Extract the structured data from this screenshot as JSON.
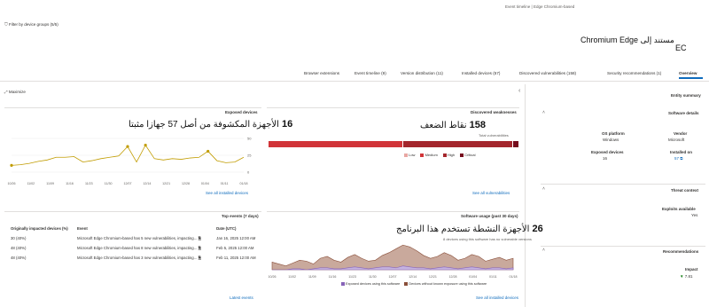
{
  "breadcrumb": {
    "item1": "Event timeline",
    "sep": "|",
    "item2": "Edge Chromium-based"
  },
  "filter_label": "Filter by device groups (5/5)",
  "header": {
    "avatar_initials": "EC",
    "title": "مستند إلى Chromium Edge"
  },
  "tabs": [
    "Overview",
    "Security recommendations (1)",
    "Discovered vulnerabilities (158)",
    "Installed devices (57)",
    "Version distribution (11)",
    "Event timeline (9)",
    "Browser extensions"
  ],
  "maximize_label": "Maximize",
  "entity_summary": {
    "title": "Entity summary",
    "software_details": {
      "title": "Software details",
      "vendor_label": "Vendor",
      "vendor_value": "Microsoft",
      "os_label": "OS platform",
      "os_value": "Windows",
      "exposed_label": "Exposed devices",
      "exposed_value": "16",
      "installed_label": "Installed on",
      "installed_value": "57"
    },
    "threat_context": {
      "title": "Threat context",
      "exploits_label": "Exploits available",
      "exploits_value": "Yes"
    },
    "recommendations": {
      "title": "Recommendations",
      "impact_label": "Impact",
      "impact_value": "7.81"
    }
  },
  "discovered_weaknesses": {
    "title": "Discovered weaknesses",
    "count": "158",
    "caption": "نقاط الضعف",
    "subtitle": "Total vulnerabilities",
    "legend": [
      "Critical",
      "High",
      "Medium",
      "Low"
    ],
    "colors": {
      "critical": "#750b1c",
      "high": "#a4262c",
      "medium": "#d13438",
      "low": "#e8a7a3"
    },
    "segments": [
      0.02,
      0.44,
      0.54,
      0.0
    ],
    "link": "See all vulnerabilities"
  },
  "exposed_devices": {
    "title": "Exposed devices",
    "count": "16",
    "caption": "الأجهزة المكشوفة من أصل 57 جهازا مثبتا",
    "link": "See all installed devices"
  },
  "software_usage": {
    "title": "Software usage (past 30 days)",
    "count": "26",
    "caption": "الأجهزة النشطة تستخدم هذا البرنامج",
    "subtitle": "8 devices using this software has no vulnerable versions",
    "legend": [
      "Devices without known exposure using this software",
      "Exposed devices using this software"
    ],
    "colors": {
      "total": "#8a4f3a",
      "total_fill": "#c9a99c",
      "exposed": "#8764b8",
      "exposed_fill": "#c5b3e0"
    },
    "link": "See all installed devices"
  },
  "top_events": {
    "title": "Top events (7 days)",
    "columns": [
      "Date (UTC)",
      "Event",
      "Originally impacted devices (%)"
    ],
    "rows": [
      {
        "date": "Jan 16, 2025 12:00 AM",
        "event": "Microsoft Edge Chromium-based has 5 new vulnerabilities, impacting...",
        "pct": "30 (40%)"
      },
      {
        "date": "Feb 5, 2025 12:00 AM",
        "event": "Microsoft Edge Chromium-based has 8 new vulnerabilities, impacting...",
        "pct": "48 (40%)"
      },
      {
        "date": "Feb 11, 2025 12:00 AM",
        "event": "Microsoft Edge Chromium-based has 3 new vulnerabilities, impacting...",
        "pct": "48 (40%)"
      }
    ],
    "link": "Latest events"
  },
  "chart_data": [
    {
      "type": "line",
      "title": "Exposed devices",
      "x": [
        "10/26",
        "11/02",
        "11/09",
        "11/16",
        "11/23",
        "11/30",
        "12/07",
        "12/14",
        "12/21",
        "12/28",
        "01/04",
        "01/11",
        "01/18"
      ],
      "series": [
        {
          "values": [
            10,
            11,
            13,
            16,
            18,
            22,
            22,
            23,
            15,
            17,
            20,
            22,
            24,
            38,
            15,
            40,
            20,
            18,
            20,
            19,
            21,
            22,
            31,
            17,
            14,
            15,
            22
          ]
        }
      ],
      "yticks": [
        "50",
        "25",
        "0"
      ],
      "ylim": [
        0,
        50
      ],
      "color": "#c19c00"
    },
    {
      "type": "area",
      "title": "Software usage (past 30 days)",
      "x": [
        "10/26",
        "11/02",
        "11/09",
        "11/16",
        "11/23",
        "11/30",
        "12/07",
        "12/14",
        "12/21",
        "12/28",
        "01/04",
        "01/11",
        "01/18"
      ],
      "series": [
        {
          "name": "Devices without known exposure using this software",
          "values": [
            8,
            6,
            4,
            7,
            10,
            9,
            6,
            12,
            14,
            10,
            8,
            13,
            16,
            12,
            9,
            10,
            15,
            18,
            22,
            26,
            24,
            20,
            15,
            12,
            14,
            18,
            15,
            10,
            12,
            16,
            14,
            9,
            11,
            13,
            10,
            12
          ]
        },
        {
          "name": "Exposed devices using this software",
          "values": [
            0,
            0,
            0,
            1,
            1,
            0,
            1,
            2,
            2,
            1,
            1,
            2,
            3,
            2,
            1,
            2,
            3,
            3,
            2,
            4,
            3,
            2,
            2,
            1,
            2,
            3,
            2,
            1,
            2,
            3,
            2,
            1,
            2,
            2,
            1,
            2
          ]
        }
      ],
      "ylim": [
        0,
        28
      ]
    }
  ]
}
